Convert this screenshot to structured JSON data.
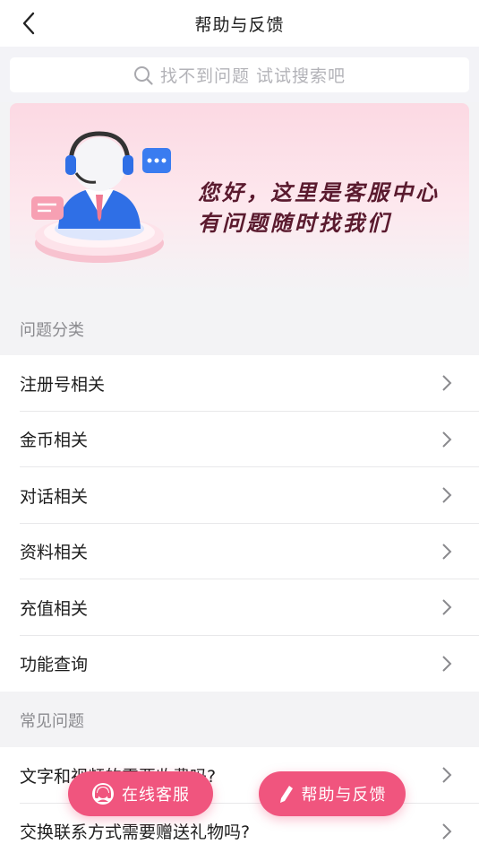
{
  "header": {
    "title": "帮助与反馈",
    "back_icon": "back-arrow-icon"
  },
  "search": {
    "placeholder": "找不到问题 试试搜索吧",
    "icon": "search-icon"
  },
  "banner": {
    "line1": "您好，这里是客服中心",
    "line2": "有问题随时找我们",
    "image": "customer-service-mascot"
  },
  "categories": {
    "title": "问题分类",
    "items": [
      {
        "label": "注册号相关"
      },
      {
        "label": "金币相关"
      },
      {
        "label": "对话相关"
      },
      {
        "label": "资料相关"
      },
      {
        "label": "充值相关"
      },
      {
        "label": "功能查询"
      }
    ]
  },
  "faq": {
    "title": "常见问题",
    "items": [
      {
        "label": "文字和视频的需要收费吗?"
      },
      {
        "label": "交换联系方式需要赠送礼物吗?"
      }
    ]
  },
  "actions": {
    "online_service": "在线客服",
    "feedback": "帮助与反馈"
  },
  "colors": {
    "accent": "#f0557e",
    "background": "#f3f3f5"
  }
}
